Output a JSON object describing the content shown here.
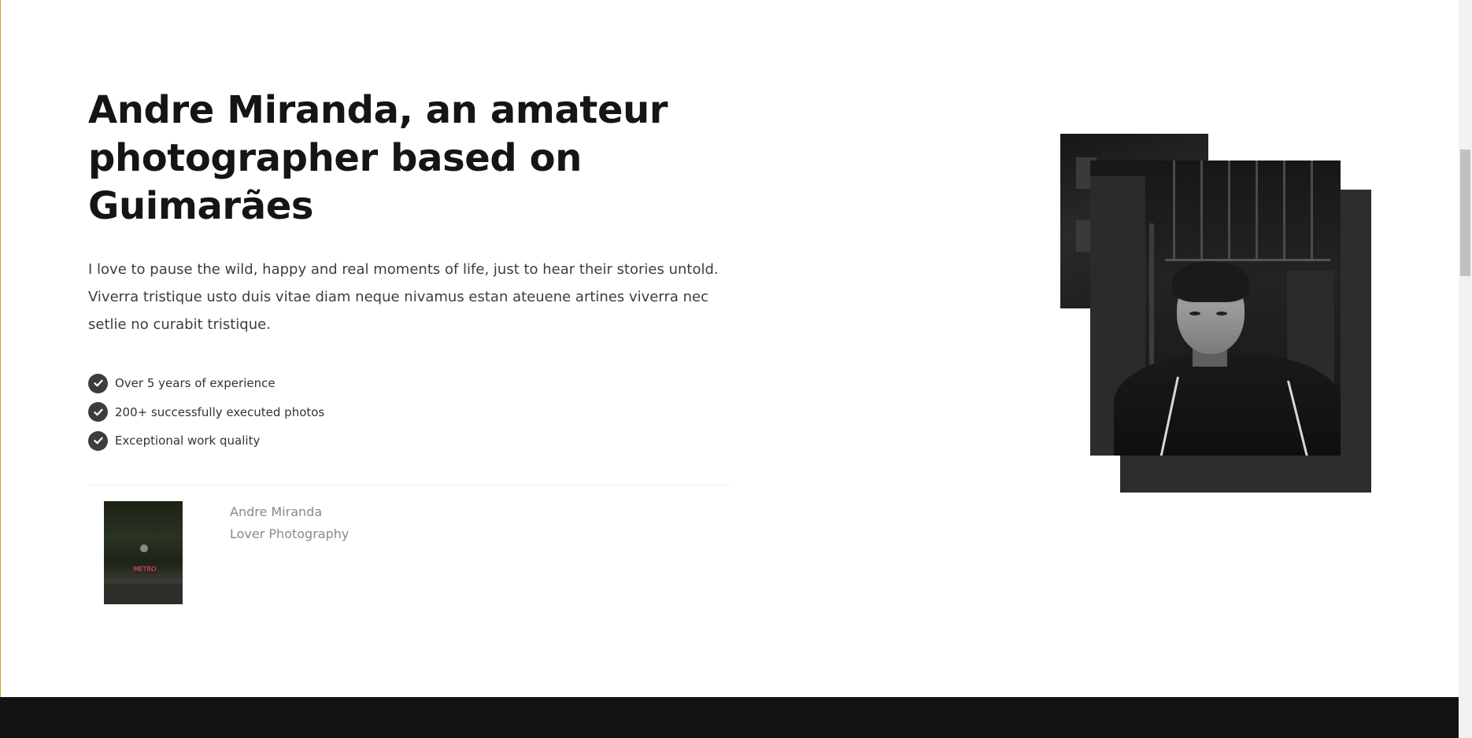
{
  "about": {
    "headline_line1": "Andre Miranda, an amateur",
    "headline_line2": "photographer based on Guimarães",
    "intro": "I love to pause the wild, happy and real moments of life, just to hear their stories untold. Viverra tristique usto duis vitae diam neque nivamus estan ateuene artines viverra nec setlie no curabit tristique.",
    "features": [
      {
        "icon": "check-circle-icon",
        "label": "Over 5 years of experience"
      },
      {
        "icon": "check-circle-icon",
        "label": "200+ successfully executed photos"
      },
      {
        "icon": "check-circle-icon",
        "label": "Exceptional work quality"
      }
    ],
    "author": {
      "name": "Andre Miranda",
      "role": "Lover Photography",
      "thumb_sign": "METRO"
    }
  },
  "colors": {
    "heading": "#151515",
    "body_text": "#3d3d3d",
    "muted_text": "#8a8a8a",
    "check_bg": "#3d3d3d",
    "dark_block": "#2d2d2d",
    "footer_band": "#121212",
    "left_accent": "#c9a227"
  }
}
